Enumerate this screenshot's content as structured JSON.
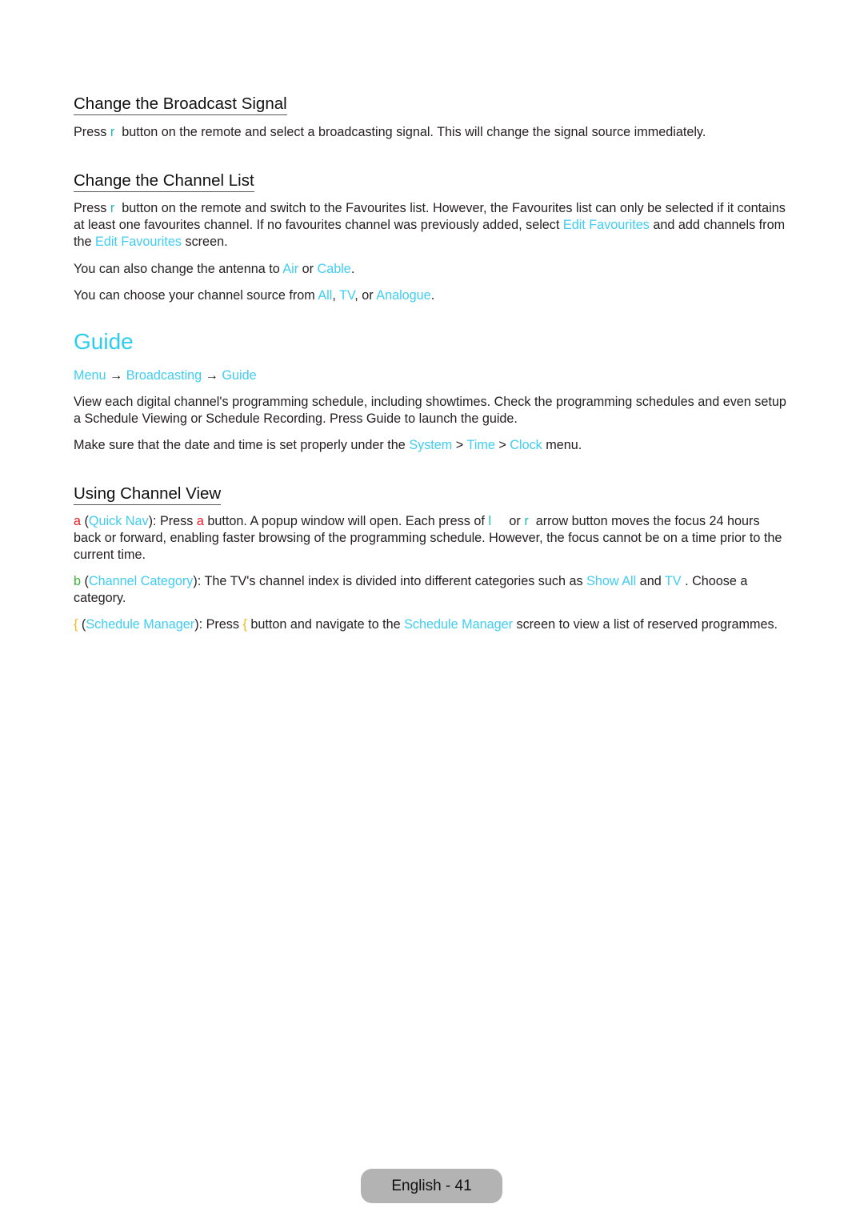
{
  "sections": {
    "broadcast_signal": {
      "heading": "Change the Broadcast Signal",
      "p1": {
        "t1": "Press ",
        "key": "r",
        "t2": "  button on the remote and select a broadcasting signal. This will change the signal source immediately."
      }
    },
    "channel_list": {
      "heading": "Change the Channel List",
      "p1": {
        "t1": "Press ",
        "key": "r",
        "t2": "  button on the remote and switch to the Favourites list. However, the Favourites list can only be selected if it contains at least one favourites channel. If no favourites channel was previously added, select ",
        "link1": "Edit Favourites",
        "t3": " and add channels from the ",
        "link2": "Edit Favourites",
        "t4": " screen."
      },
      "p2": {
        "t1": "You can also change the antenna to ",
        "link1": "Air",
        "t2": " or ",
        "link2": "Cable",
        "t3": "."
      },
      "p3": {
        "t1": "You can choose your channel source from ",
        "link1": "All",
        "t2": ", ",
        "link2": "TV",
        "t3": ", or ",
        "link3": "Analogue",
        "t4": "."
      }
    },
    "guide": {
      "title": "Guide",
      "path": {
        "item1": "Menu",
        "arrow1": " → ",
        "item2": "Broadcasting",
        "arrow2": " → ",
        "item3": "Guide"
      },
      "p1": "View each digital channel's programming schedule, including showtimes. Check the programming schedules and even setup a Schedule Viewing or Schedule Recording. Press Guide to launch the guide.",
      "p2": {
        "t1": "Make sure that the date and time is set properly under the ",
        "link1": "System",
        "t2": " > ",
        "link2": "Time",
        "t3": " > ",
        "link3": "Clock",
        "t4": " menu."
      }
    },
    "channel_view": {
      "heading": "Using Channel View",
      "item_a": {
        "key": "a",
        "t1": " (",
        "link1": "Quick Nav",
        "t2": "): Press ",
        "key2": "a",
        "t3": " button. A popup window will open. Each press of ",
        "key3": "l",
        "t4": "     or ",
        "key4": "r",
        "t5": "  arrow button moves the focus 24 hours back or forward, enabling faster browsing of the programming schedule. However, the focus cannot be on a time prior to the current time."
      },
      "item_b": {
        "key": "b",
        "t1": " (",
        "link1": "Channel Category",
        "t2": "): The TV's channel index is divided into different categories such as ",
        "link2": "Show All",
        "t3": " and ",
        "link3": "TV",
        "t4": " . Choose a category."
      },
      "item_c": {
        "key": "{",
        "t1": " (",
        "link1": "Schedule Manager",
        "t2": "): Press ",
        "key2": "{",
        "t3": " button and navigate to the ",
        "link2": "Schedule Manager",
        "t4": " screen to view a list of reserved programmes."
      }
    }
  },
  "footer": {
    "label": "English - 41"
  },
  "colors": {
    "highlight": "#3fcdf2",
    "title": "#2ccdf0",
    "key_teal": "#1fbfae",
    "key_red": "#ee1c25",
    "key_green": "#3bb53b",
    "key_yellow": "#f9b715",
    "footer_bg": "#b3b3b3"
  }
}
